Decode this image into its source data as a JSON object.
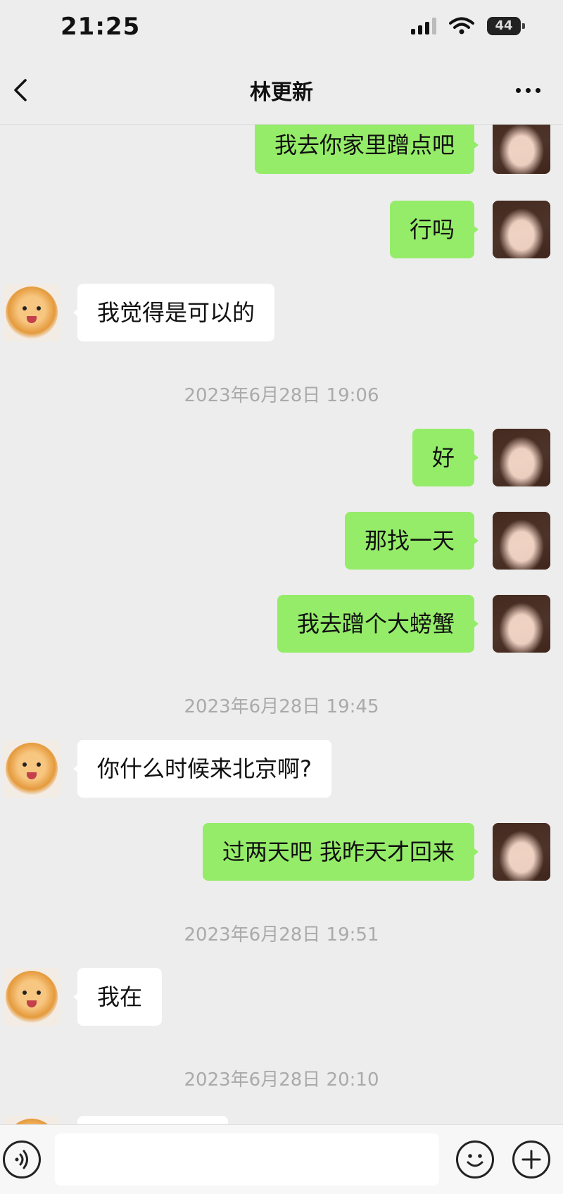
{
  "status_bar": {
    "time": "21:25",
    "battery": "44"
  },
  "header": {
    "title": "林更新"
  },
  "messages": [
    {
      "side": "out",
      "text": "我去你家里蹭点吧"
    },
    {
      "side": "out",
      "text": "行吗"
    },
    {
      "side": "in",
      "text": "我觉得是可以的"
    },
    {
      "side": "out",
      "text": "好"
    },
    {
      "side": "out",
      "text": "那找一天"
    },
    {
      "side": "out",
      "text": "我去蹭个大螃蟹"
    },
    {
      "side": "in",
      "text": "你什么时候来北京啊?"
    },
    {
      "side": "out",
      "text": "过两天吧 我昨天才回来"
    },
    {
      "side": "in",
      "text": "我在"
    }
  ],
  "timestamps": [
    "2023年6月28日 19:06",
    "2023年6月28日 19:45",
    "2023年6月28日 19:51",
    "2023年6月28日 20:10"
  ],
  "colors": {
    "outgoing_bubble": "#95ec69",
    "incoming_bubble": "#ffffff",
    "background": "#ededed"
  },
  "icons": [
    "back-chevron-icon",
    "more-icon",
    "voice-icon",
    "emoji-icon",
    "plus-icon",
    "signal-icon",
    "wifi-icon",
    "battery-icon"
  ]
}
